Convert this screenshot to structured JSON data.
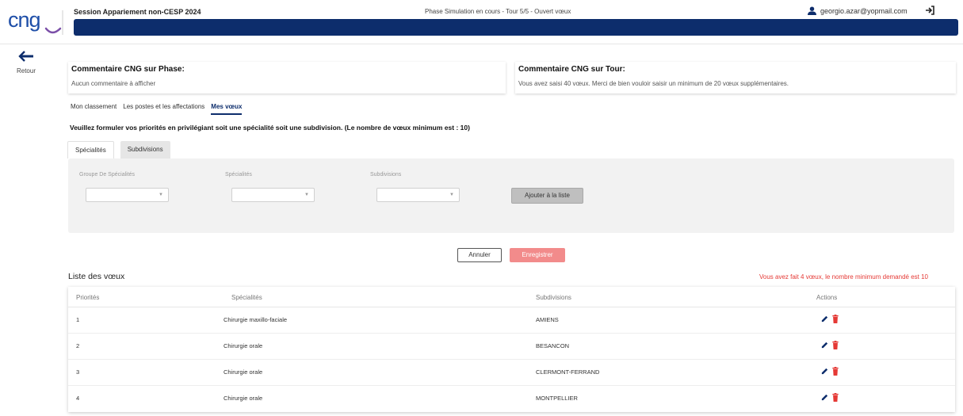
{
  "header": {
    "session_title": "Session Appariement non-CESP 2024",
    "phase_status": "Phase Simulation en cours - Tour 5/5 - Ouvert vœux",
    "user_email": "georgio.azar@yopmail.com",
    "logo_text": "CNG"
  },
  "nav": {
    "back_label": "Retour"
  },
  "comments": {
    "phase_title": "Commentaire CNG sur Phase:",
    "phase_text": "Aucun commentaire à afficher",
    "tour_title": "Commentaire CNG sur Tour:",
    "tour_text": "Vous avez saisi 40 vœux. Merci de bien vouloir saisir un minimum de 20 vœux supplémentaires."
  },
  "tabs": [
    {
      "label": "Mon classement"
    },
    {
      "label": "Les postes et les affectations"
    },
    {
      "label": "Mes vœux"
    }
  ],
  "instruction": "Veuillez formuler vos priorités en privilégiant soit une spécialité soit une subdivision. (Le nombre de vœux minimum est : 10)",
  "subtabs": [
    {
      "label": "Spécialités"
    },
    {
      "label": "Subdivisions"
    }
  ],
  "filters": {
    "groupe_label": "Groupe De Spécialités",
    "specialites_label": "Spécialités",
    "subdivisions_label": "Subdivisions",
    "add_button": "Ajouter à la liste"
  },
  "buttons": {
    "cancel": "Annuler",
    "save": "Enregistrer"
  },
  "list": {
    "title": "Liste des vœux",
    "warning": "Vous avez fait 4 vœux, le nombre minimum demandé est 10",
    "columns": [
      "Priorités",
      "Spécialités",
      "Subdivisions",
      "Actions"
    ],
    "rows": [
      {
        "priority": "1",
        "specialite": "Chirurgie maxillo-faciale",
        "subdivision": "AMIENS"
      },
      {
        "priority": "2",
        "specialite": "Chirurgie orale",
        "subdivision": "BESANCON"
      },
      {
        "priority": "3",
        "specialite": "Chirurgie orale",
        "subdivision": "CLERMONT-FERRAND"
      },
      {
        "priority": "4",
        "specialite": "Chirurgie orale",
        "subdivision": "MONTPELLIER"
      }
    ]
  },
  "colors": {
    "brand_navy": "#0d2d6c",
    "logo_blue": "#1f4fa8",
    "logo_purple": "#7b4fa8",
    "danger_red": "#e53935",
    "save_pink": "#f28b8b"
  },
  "icons": [
    "arrow-left-icon",
    "user-icon",
    "logout-icon",
    "pencil-icon",
    "trash-icon",
    "caret-down-icon"
  ]
}
